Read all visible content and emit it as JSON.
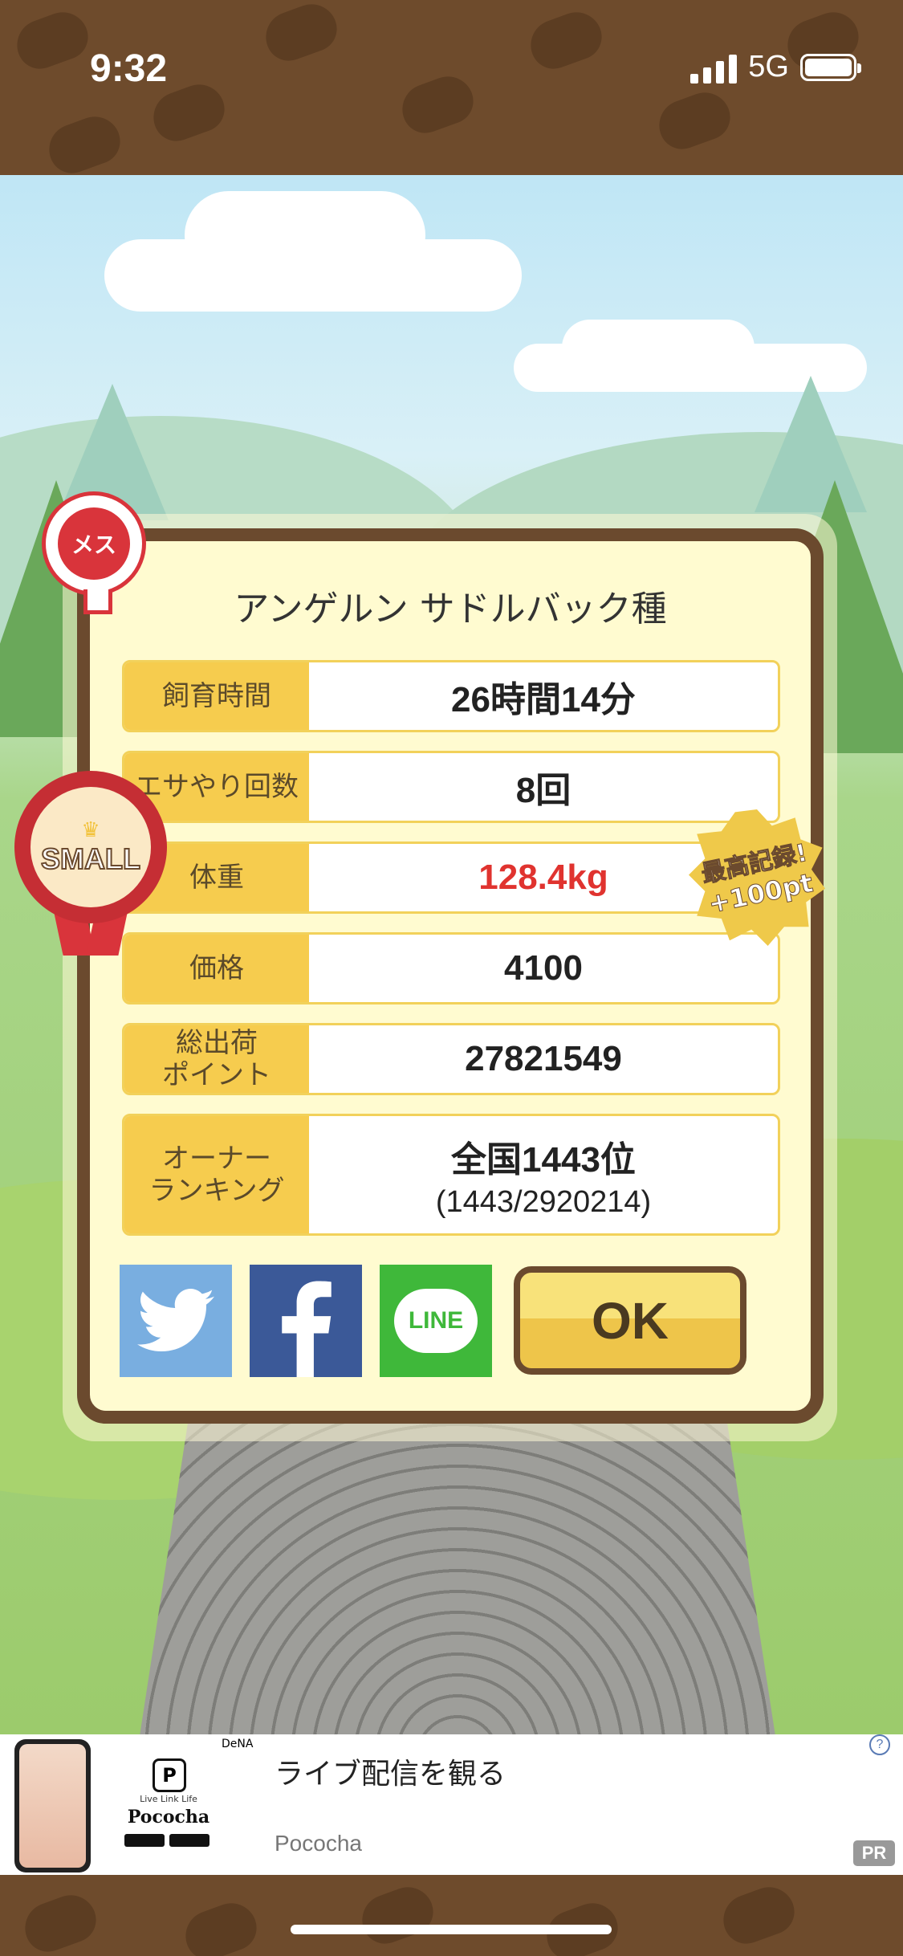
{
  "status_bar": {
    "time": "9:32",
    "network": "5G"
  },
  "dialog": {
    "title": "アンゲルン サドルバック種",
    "rows": [
      {
        "label": "飼育時間",
        "value": "26時間14分"
      },
      {
        "label": "エサやり回数",
        "value": "8回"
      },
      {
        "label": "体重",
        "value": "128.4kg",
        "value_color": "#e0332f"
      },
      {
        "label": "価格",
        "value": "4100"
      },
      {
        "label_line1": "総出荷",
        "label_line2": "ポイント",
        "value": "27821549"
      },
      {
        "label_line1": "オーナー",
        "label_line2": "ランキング",
        "value": "全国1443位",
        "sub": "(1443/2920214)"
      }
    ],
    "share": {
      "twitter_icon": "twitter-icon",
      "facebook_icon": "facebook-icon",
      "line_label": "LINE"
    },
    "ok_label": "OK"
  },
  "badges": {
    "female": "メス",
    "size": "SMALL",
    "record_line1": "最高記録!",
    "record_line2": "+100pt"
  },
  "ad": {
    "brand_small": "DeNA",
    "app_tagline": "Live Link Life",
    "app_name": "Pococha",
    "headline": "ライブ配信を観る",
    "advertiser": "Pococha",
    "pr_label": "PR",
    "info_icon": "?"
  },
  "colors": {
    "brown": "#6b4a2e",
    "label_yellow": "#f6cc4e",
    "dialog_bg": "#fffbd0",
    "twitter": "#79aee0",
    "facebook": "#3b5998",
    "line": "#3fb83a"
  }
}
